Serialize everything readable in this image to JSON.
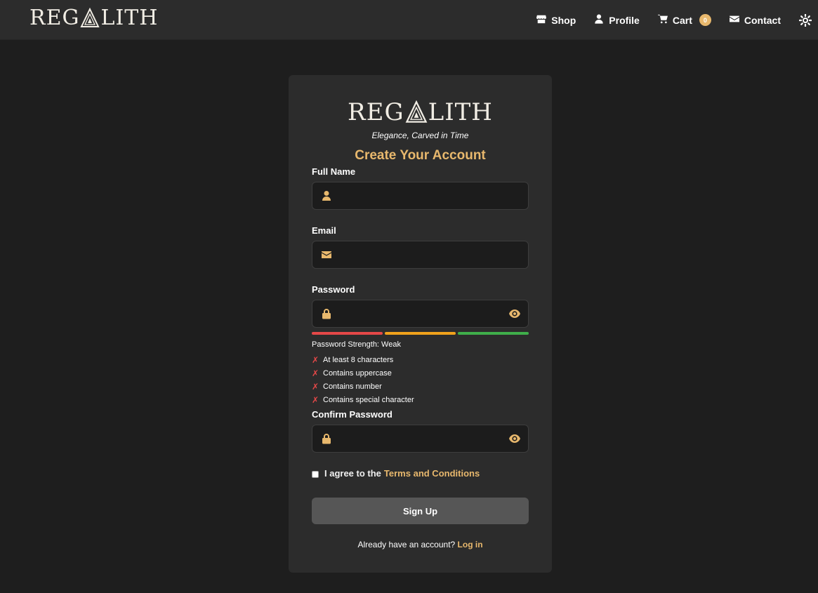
{
  "header": {
    "brand": {
      "text_left": "REG",
      "text_right": "LITH"
    },
    "nav": [
      {
        "label": "Shop",
        "icon": "store-icon"
      },
      {
        "label": "Profile",
        "icon": "user-icon"
      },
      {
        "label": "Cart",
        "icon": "cart-icon",
        "badge": "0"
      },
      {
        "label": "Contact",
        "icon": "envelope-icon"
      }
    ],
    "theme_toggle_icon": "sun-icon"
  },
  "form": {
    "logo": {
      "text_left": "REG",
      "text_right": "LITH"
    },
    "tagline": "Elegance, Carved in Time",
    "title": "Create Your Account",
    "full_name": {
      "label": "Full Name",
      "value": "",
      "icon": "user-icon"
    },
    "email": {
      "label": "Email",
      "value": "",
      "icon": "envelope-icon"
    },
    "password": {
      "label": "Password",
      "value": "",
      "icon": "lock-icon",
      "toggle_icon": "eye-icon"
    },
    "strength": {
      "text": "Password Strength: Weak",
      "bar_colors": [
        "#e54848",
        "#f0a21c",
        "#3fae4a"
      ]
    },
    "requirements": [
      {
        "mark": "✗",
        "label": "At least 8 characters"
      },
      {
        "mark": "✗",
        "label": "Contains uppercase"
      },
      {
        "mark": "✗",
        "label": "Contains number"
      },
      {
        "mark": "✗",
        "label": "Contains special character"
      }
    ],
    "confirm_password": {
      "label": "Confirm Password",
      "value": "",
      "icon": "lock-icon",
      "toggle_icon": "eye-icon"
    },
    "agree": {
      "prefix": "I agree to the",
      "link": "Terms and Conditions",
      "checked": false
    },
    "submit_label": "Sign Up",
    "login": {
      "prefix": "Already have an account?",
      "link": "Log in"
    }
  },
  "colors": {
    "accent": "#e8b86d",
    "background": "#1e1e1e",
    "card": "#2c2c2c",
    "error": "#e54848"
  }
}
